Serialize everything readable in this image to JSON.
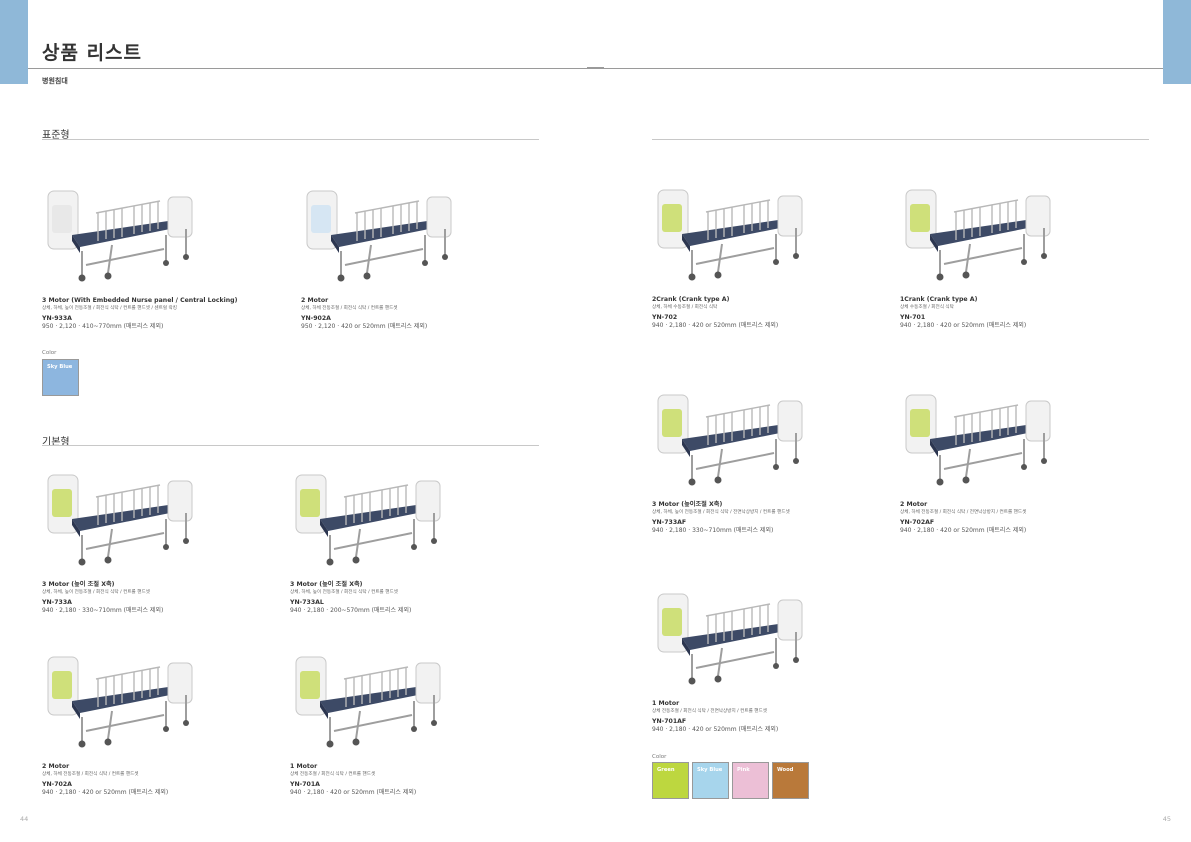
{
  "page": {
    "title": "상품 리스트",
    "category": "병원침대",
    "page_left": "44",
    "page_right": "45"
  },
  "sections": {
    "standard": "표준형",
    "basic": "기본형"
  },
  "colors_label": "Color",
  "swatches_left": [
    {
      "label": "Sky Blue",
      "color": "#8db6df"
    }
  ],
  "swatches_right": [
    {
      "label": "Green",
      "color": "#bdd73f"
    },
    {
      "label": "Sky Blue",
      "color": "#a7d5ec"
    },
    {
      "label": "Pink",
      "color": "#ecbfd6"
    },
    {
      "label": "Wood",
      "color": "#b9793a"
    }
  ],
  "products": [
    {
      "name": "3 Motor (With Embedded Nurse panel / Central Locking)",
      "desc": "상체, 하체, 높이 전동조절 / 회전식 식탁 / 컨트롤 핸드셋 / 센트럴 락킹",
      "model": "YN-933A",
      "spec": "950 ‧ 2,120 ‧ 410~770mm (매트리스 제외)",
      "accent": "#e8e8e8"
    },
    {
      "name": "2 Motor",
      "desc": "상체, 하체 전동조절 / 회전식 식탁 / 컨트롤 핸드셋",
      "model": "YN-902A",
      "spec": "950 ‧ 2,120 ‧ 420 or 520mm (매트리스 제외)",
      "accent": "#d6e6f3"
    },
    {
      "name": "3 Motor (높이 조절 X축)",
      "desc": "상체, 하체, 높이 전동조절 / 회전식 식탁 / 컨트롤 핸드셋",
      "model": "YN-733A",
      "spec": "940 ‧ 2,180 ‧ 330~710mm (매트리스 제외)",
      "accent": "#cfe07a"
    },
    {
      "name": "3 Motor (높이 조절 X축)",
      "desc": "상체, 하체, 높이 전동조절 / 회전식 식탁 / 컨트롤 핸드셋",
      "model": "YN-733AL",
      "spec": "940 ‧ 2,180 ‧ 200~570mm (매트리스 제외)",
      "accent": "#cfe07a"
    },
    {
      "name": "2 Motor",
      "desc": "상체, 하체 전동조절 / 회전식 식탁 / 컨트롤 핸드셋",
      "model": "YN-702A",
      "spec": "940 ‧ 2,180 ‧ 420 or 520mm (매트리스 제외)",
      "accent": "#cfe07a"
    },
    {
      "name": "1 Motor",
      "desc": "상체 전동조절 / 회전식 식탁 / 컨트롤 핸드셋",
      "model": "YN-701A",
      "spec": "940 ‧ 2,180 ‧ 420 or 520mm (매트리스 제외)",
      "accent": "#cfe07a"
    },
    {
      "name": "2Crank (Crank type A)",
      "desc": "상체, 하체 수동조절 / 회전식 식탁",
      "model": "YN-702",
      "spec": "940 ‧ 2,180 ‧ 420 or 520mm (매트리스 제외)",
      "accent": "#cfe07a"
    },
    {
      "name": "1Crank (Crank type A)",
      "desc": "상체 수동조절 / 회전식 식탁",
      "model": "YN-701",
      "spec": "940 ‧ 2,180 ‧ 420 or 520mm (매트리스 제외)",
      "accent": "#cfe07a"
    },
    {
      "name": "3 Motor (높이조절 X축)",
      "desc": "상체, 하체, 높이 전동조절 / 회전식 식탁 / 전면낙상방지 / 컨트롤 핸드셋",
      "model": "YN-733AF",
      "spec": "940 ‧ 2,180 ‧ 330~710mm (매트리스 제외)",
      "accent": "#cfe07a"
    },
    {
      "name": "2 Motor",
      "desc": "상체, 하체 전동조절 / 회전식 식탁 / 전면낙상방지 / 컨트롤 핸드셋",
      "model": "YN-702AF",
      "spec": "940 ‧ 2,180 ‧ 420 or 520mm (매트리스 제외)",
      "accent": "#cfe07a"
    },
    {
      "name": "1 Motor",
      "desc": "상체 전동조절 / 회전식 식탁 / 전면낙상방지 / 컨트롤 핸드셋",
      "model": "YN-701AF",
      "spec": "940 ‧ 2,180 ‧ 420 or 520mm (매트리스 제외)",
      "accent": "#cfe07a"
    }
  ]
}
